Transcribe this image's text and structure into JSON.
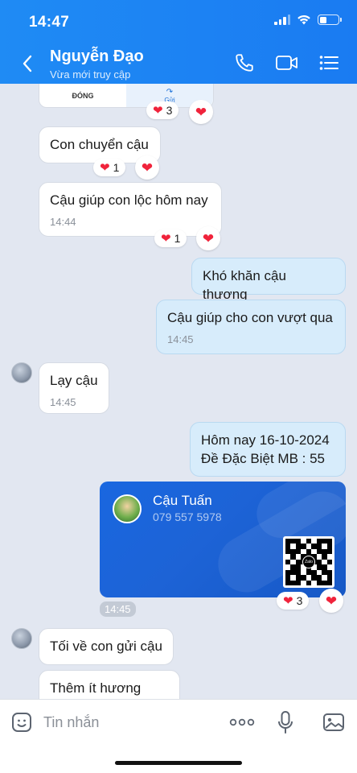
{
  "status_bar": {
    "time": "14:47"
  },
  "header": {
    "contact_name": "Nguyễn Đạo",
    "contact_status": "Vừa mới truy cập",
    "icons": [
      "back-arrow-icon",
      "phone-icon",
      "video-call-icon",
      "menu-list-icon"
    ]
  },
  "prev_card": {
    "left_label": "ĐÓNG",
    "right_label": "Gửi",
    "reaction_count": "3"
  },
  "messages": [
    {
      "text": "Con chuyển cậu",
      "reaction_count": "1"
    },
    {
      "text": "Cậu giúp con lộc hôm nay",
      "time": "14:44",
      "reaction_count": "1"
    },
    {
      "text": "Khó khăn cậu thương"
    },
    {
      "text": "Cậu giúp cho con vượt qua",
      "time": "14:45"
    },
    {
      "text": "Lạy cậu",
      "time": "14:45"
    },
    {
      "line1": "Hôm nay 16-10-2024",
      "line2": "Đề Đặc Biệt MB : 55"
    },
    {
      "text": "Tối về con gửi cậu"
    },
    {
      "text": "Thêm ít hương khói"
    }
  ],
  "contact_card": {
    "name": "Cậu Tuấn",
    "phone": "079 557 5978",
    "time": "14:45",
    "reaction_count": "3",
    "qr_logo": "Zalo"
  },
  "composer": {
    "placeholder": "Tin nhắn"
  },
  "colors": {
    "header": "#1a7bf2",
    "outgoing_bubble": "#d7ecfb",
    "heart": "#f0233b",
    "card": "#1967e0"
  }
}
